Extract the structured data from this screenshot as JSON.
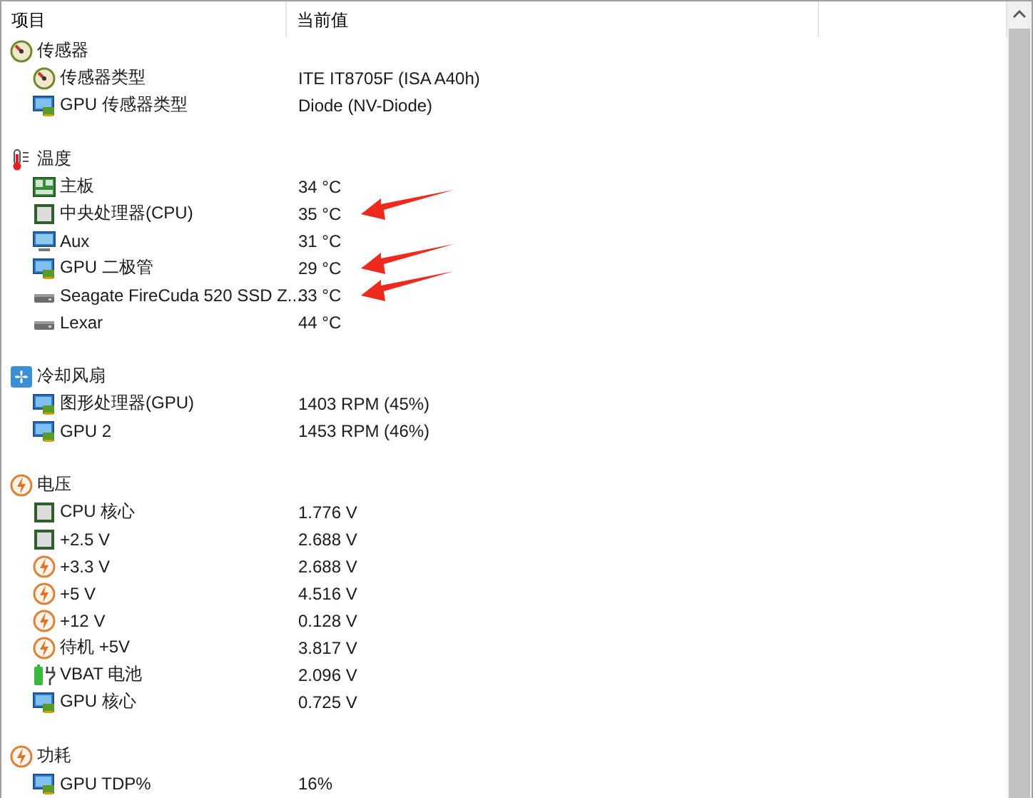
{
  "columns": [
    "项目",
    "当前值"
  ],
  "groups": [
    {
      "label": "传感器",
      "kind": "gauge",
      "items": [
        {
          "label": "传感器类型",
          "kind": "gauge",
          "value": "ITE IT8705F  (ISA A40h)",
          "marked": false
        },
        {
          "label": "GPU 传感器类型",
          "kind": "gpu",
          "value": "Diode  (NV-Diode)",
          "marked": false
        }
      ]
    },
    {
      "label": "温度",
      "kind": "thermometer",
      "items": [
        {
          "label": "主板",
          "kind": "board",
          "value": "34 °C",
          "marked": false
        },
        {
          "label": "中央处理器(CPU)",
          "kind": "chip",
          "value": "35 °C",
          "marked": true
        },
        {
          "label": "Aux",
          "kind": "monitor",
          "value": "31 °C",
          "marked": false
        },
        {
          "label": "GPU 二极管",
          "kind": "gpu",
          "value": "29 °C",
          "marked": true
        },
        {
          "label": "Seagate FireCuda 520 SSD Z...",
          "kind": "drive",
          "value": "33 °C",
          "marked": true
        },
        {
          "label": "Lexar",
          "kind": "drive",
          "value": "44 °C",
          "marked": false
        }
      ]
    },
    {
      "label": "冷却风扇",
      "kind": "fan",
      "items": [
        {
          "label": "图形处理器(GPU)",
          "kind": "gpu",
          "value": "1403 RPM  (45%)",
          "marked": false
        },
        {
          "label": "GPU 2",
          "kind": "gpu",
          "value": "1453 RPM  (46%)",
          "marked": false
        }
      ]
    },
    {
      "label": "电压",
      "kind": "bolt",
      "items": [
        {
          "label": "CPU 核心",
          "kind": "chip",
          "value": "1.776 V",
          "marked": false
        },
        {
          "label": "+2.5 V",
          "kind": "chip",
          "value": "2.688 V",
          "marked": false
        },
        {
          "label": "+3.3 V",
          "kind": "bolt",
          "value": "2.688 V",
          "marked": false
        },
        {
          "label": "+5 V",
          "kind": "bolt",
          "value": "4.516 V",
          "marked": false
        },
        {
          "label": "+12 V",
          "kind": "bolt",
          "value": "0.128 V",
          "marked": false
        },
        {
          "label": "待机 +5V",
          "kind": "bolt",
          "value": "3.817 V",
          "marked": false
        },
        {
          "label": "VBAT 电池",
          "kind": "battery",
          "value": "2.096 V",
          "marked": false
        },
        {
          "label": "GPU 核心",
          "kind": "gpu",
          "value": "0.725 V",
          "marked": false
        }
      ]
    },
    {
      "label": "功耗",
      "kind": "bolt",
      "items": [
        {
          "label": "GPU TDP%",
          "kind": "gpu",
          "value": "16%",
          "marked": false
        }
      ]
    }
  ]
}
